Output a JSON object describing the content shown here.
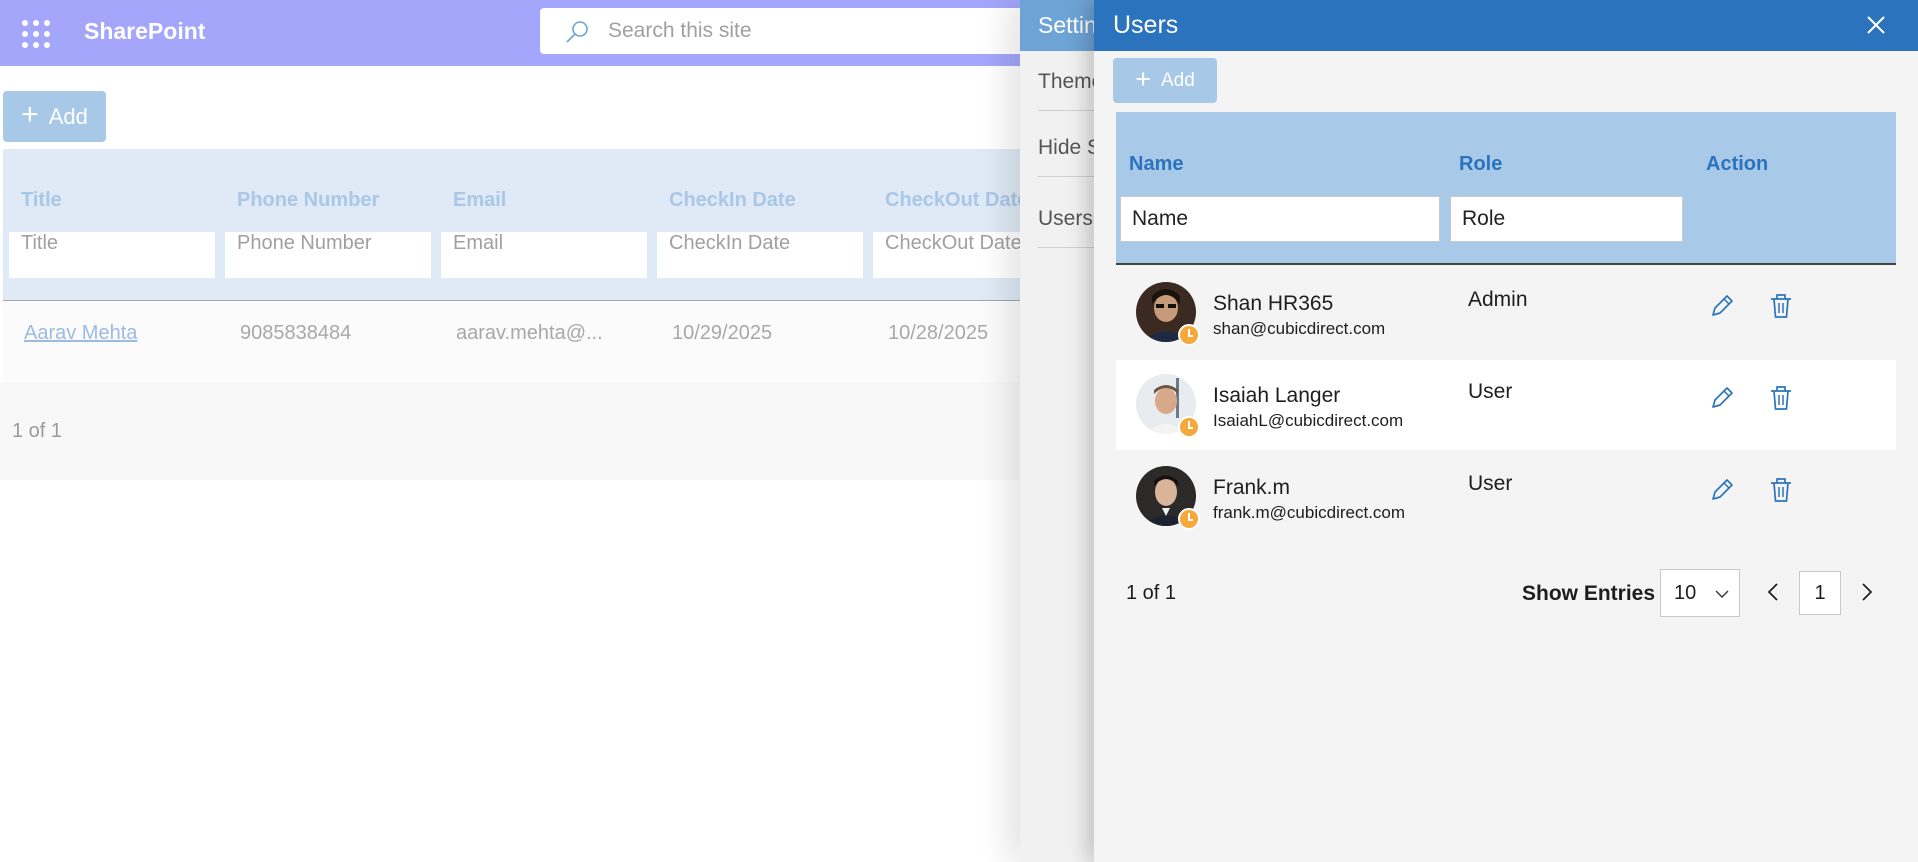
{
  "topbar": {
    "app_name": "SharePoint",
    "search_placeholder": "Search this site"
  },
  "background_list": {
    "add_label": "Add",
    "columns": [
      "Title",
      "Phone Number",
      "Email",
      "CheckIn Date",
      "CheckOut Date"
    ],
    "filters": [
      "Title",
      "Phone Number",
      "Email",
      "CheckIn Date",
      "CheckOut Date"
    ],
    "rows": [
      {
        "title": "Aarav Mehta",
        "phone": "9085838484",
        "email": "aarav.mehta@...",
        "checkin": "10/29/2025",
        "checkout": "10/28/2025"
      }
    ],
    "paging": "1 of 1"
  },
  "settings_panel": {
    "title": "Settings",
    "items": [
      "Theme",
      "Hide S",
      "Users"
    ]
  },
  "users_panel": {
    "title": "Users",
    "add_label": "Add",
    "columns": {
      "name": "Name",
      "role": "Role",
      "action": "Action"
    },
    "filters": {
      "name_placeholder": "Name",
      "role_placeholder": "Role"
    },
    "users": [
      {
        "name": "Shan HR365",
        "email": "shan@cubicdirect.com",
        "role": "Admin"
      },
      {
        "name": "Isaiah Langer",
        "email": "IsaiahL@cubicdirect.com",
        "role": "User"
      },
      {
        "name": "Frank.m",
        "email": "frank.m@cubicdirect.com",
        "role": "User"
      }
    ],
    "paging": {
      "count_text": "1 of 1",
      "show_entries_label": "Show Entries",
      "entries_value": "10",
      "current_page": "1"
    },
    "icons": {
      "edit": "pencil-icon",
      "delete": "trash-icon",
      "presence": "clock-presence-icon"
    },
    "colors": {
      "header": "#2b74bd",
      "table_header": "#a8c9e8",
      "presence_away": "#f6a83a"
    }
  }
}
